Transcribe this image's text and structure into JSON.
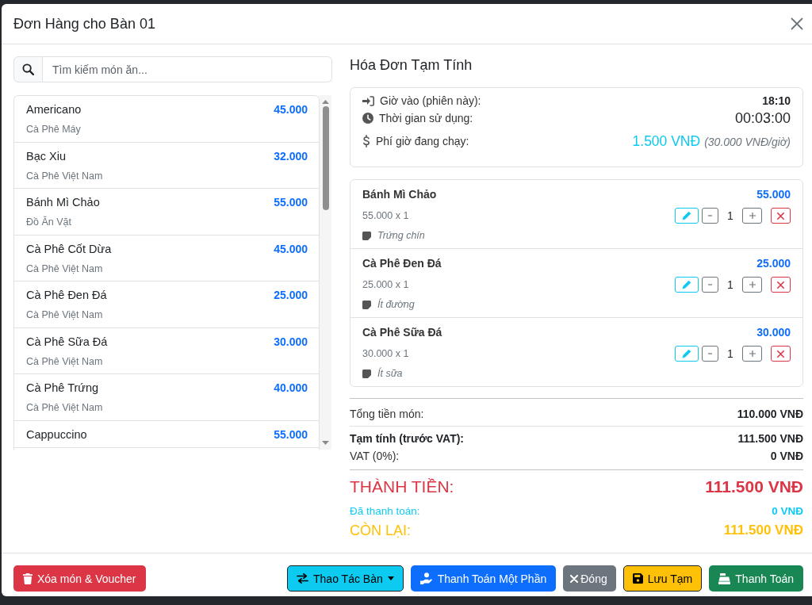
{
  "modal": {
    "title": "Đơn Hàng cho Bàn 01"
  },
  "search": {
    "placeholder": "Tìm kiếm món ăn..."
  },
  "menu_items": [
    {
      "name": "Americano",
      "category": "Cà Phê Máy",
      "price": "45.000"
    },
    {
      "name": "Bạc Xiu",
      "category": "Cà Phê Việt Nam",
      "price": "32.000"
    },
    {
      "name": "Bánh Mì Chảo",
      "category": "Đồ Ăn Vặt",
      "price": "55.000"
    },
    {
      "name": "Cà Phê Cốt Dừa",
      "category": "Cà Phê Việt Nam",
      "price": "45.000"
    },
    {
      "name": "Cà Phê Đen Đá",
      "category": "Cà Phê Việt Nam",
      "price": "25.000"
    },
    {
      "name": "Cà Phê Sữa Đá",
      "category": "Cà Phê Việt Nam",
      "price": "30.000"
    },
    {
      "name": "Cà Phê Trứng",
      "category": "Cà Phê Việt Nam",
      "price": "40.000"
    },
    {
      "name": "Cappuccino",
      "price": "55.000"
    }
  ],
  "bill": {
    "title": "Hóa Đơn Tạm Tính",
    "session": [
      {
        "kind": "check_in",
        "label": "Giờ vào (phiên này):",
        "value": "18:10"
      },
      {
        "kind": "duration",
        "label": "Thời gian sử dụng:",
        "value": "00:03:00"
      },
      {
        "kind": "fee",
        "label": "Phí giờ đang chạy:",
        "value": "1.500 VNĐ",
        "note": "(30.000 VNĐ/giờ)"
      }
    ],
    "order_items": [
      {
        "name": "Bánh Mì Chảo",
        "price": "55.000",
        "unit_line": "55.000 x 1",
        "quantity": "1",
        "note": "Trứng chín"
      },
      {
        "name": "Cà Phê Đen Đá",
        "price": "25.000",
        "unit_line": "25.000 x 1",
        "quantity": "1",
        "note": "Ít đường"
      },
      {
        "name": "Cà Phê Sữa Đá",
        "price": "30.000",
        "unit_line": "30.000 x 1",
        "quantity": "1",
        "note": "Ít sữa"
      }
    ],
    "totals": [
      {
        "kind": "items_total",
        "label": "Tổng tiền món:",
        "value": "110.000 VNĐ"
      },
      {
        "kind": "subtotal",
        "label": "Tạm tính (trước VAT):",
        "value": "111.500 VNĐ"
      },
      {
        "kind": "tax",
        "label": "VAT (0%):",
        "value": "0 VNĐ"
      },
      {
        "kind": "grand",
        "label": "THÀNH TIỀN:",
        "value": "111.500 VNĐ"
      },
      {
        "kind": "paid",
        "label": "Đã thanh toán:",
        "value": "0 VNĐ"
      },
      {
        "kind": "remaining",
        "label": "CÒN LẠI:",
        "value": "111.500 VNĐ"
      }
    ]
  },
  "footer_buttons": [
    {
      "kind": "danger",
      "label": "Xóa món & Voucher",
      "dropdown": false
    },
    {
      "kind": "info",
      "label": "Thao Tác Bàn",
      "dropdown": true
    },
    {
      "kind": "primary",
      "label": "Thanh Toán Một Phần",
      "dropdown": false
    },
    {
      "kind": "secondary",
      "label": "Đóng",
      "dropdown": false
    },
    {
      "kind": "warning",
      "label": "Lưu Tạm",
      "dropdown": false
    },
    {
      "kind": "success",
      "label": "Thanh Toán",
      "dropdown": false
    }
  ]
}
